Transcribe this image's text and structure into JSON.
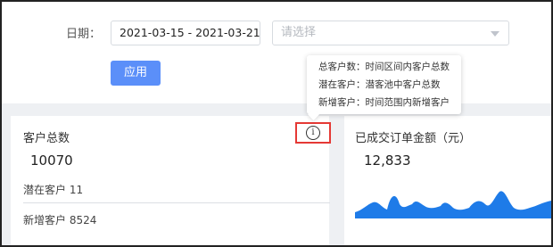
{
  "filter": {
    "date_label": "日期：",
    "date_range_value": "2021-03-15 - 2021-03-21",
    "select_placeholder": "请选择",
    "apply_label": "应用"
  },
  "tooltip": {
    "lines": [
      "总客户数：时间区间内客户总数",
      "潜在客户：潜客池中客户总数",
      "新增客户：时间范围内新增客户"
    ]
  },
  "customer_card": {
    "title": "客户总数",
    "total": "10070",
    "potential": "潜在客户 11",
    "new": "新增客户 8524"
  },
  "order_card": {
    "title": "已成交订单金额（元）",
    "amount": "12,833"
  },
  "colors": {
    "accent": "#5b8ff9",
    "chart_fill": "#1e7be8",
    "highlight": "#e53935",
    "background_strip": "#eef0f3"
  },
  "icons": {
    "info": "info-circle-icon",
    "dropdown": "caret-down-icon"
  }
}
